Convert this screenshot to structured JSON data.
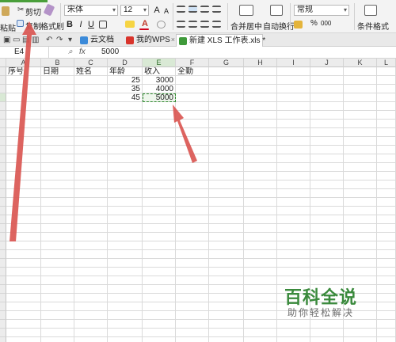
{
  "ribbon": {
    "cut_label": "剪切",
    "copy_label": "复制",
    "paste_label": "粘贴",
    "format_painter_label": "格式刷",
    "font_name": "宋体",
    "font_size": "12",
    "font_grow": "A",
    "font_shrink": "A",
    "bold": "B",
    "italic": "I",
    "underline": "U",
    "merge_center_label": "合并居中",
    "wrap_text_label": "自动换行",
    "number_format": "常规",
    "percent_symbol": "%",
    "comma_symbol": "000",
    "conditional_format_label": "条件格式",
    "dropdown_glyph": "▾"
  },
  "tabs": {
    "cloud_docs": "云文档",
    "my_wps": "我的WPS",
    "active_file": "新建 XLS 工作表.xls *",
    "close_glyph": "×"
  },
  "formula_bar": {
    "cell_ref": "E4",
    "fx_label": "fx",
    "value": "5000"
  },
  "columns": [
    "A",
    "B",
    "C",
    "D",
    "E",
    "F",
    "G",
    "H",
    "I",
    "J",
    "K",
    "L"
  ],
  "sheet": {
    "headers": {
      "A": "序号",
      "B": "日期",
      "C": "姓名",
      "D": "年龄",
      "E": "收入",
      "F": "全勤"
    },
    "rows": [
      {
        "D": "25",
        "E": "3000"
      },
      {
        "D": "35",
        "E": "4000"
      },
      {
        "D": "45",
        "E": "5000"
      }
    ]
  },
  "watermark": {
    "title": "百科全说",
    "subtitle": "助你轻松解决"
  },
  "colors": {
    "accent_green": "#4a9f3b",
    "annotation_arrow": "#d9534f",
    "selected_header": "#d9e9d5"
  }
}
